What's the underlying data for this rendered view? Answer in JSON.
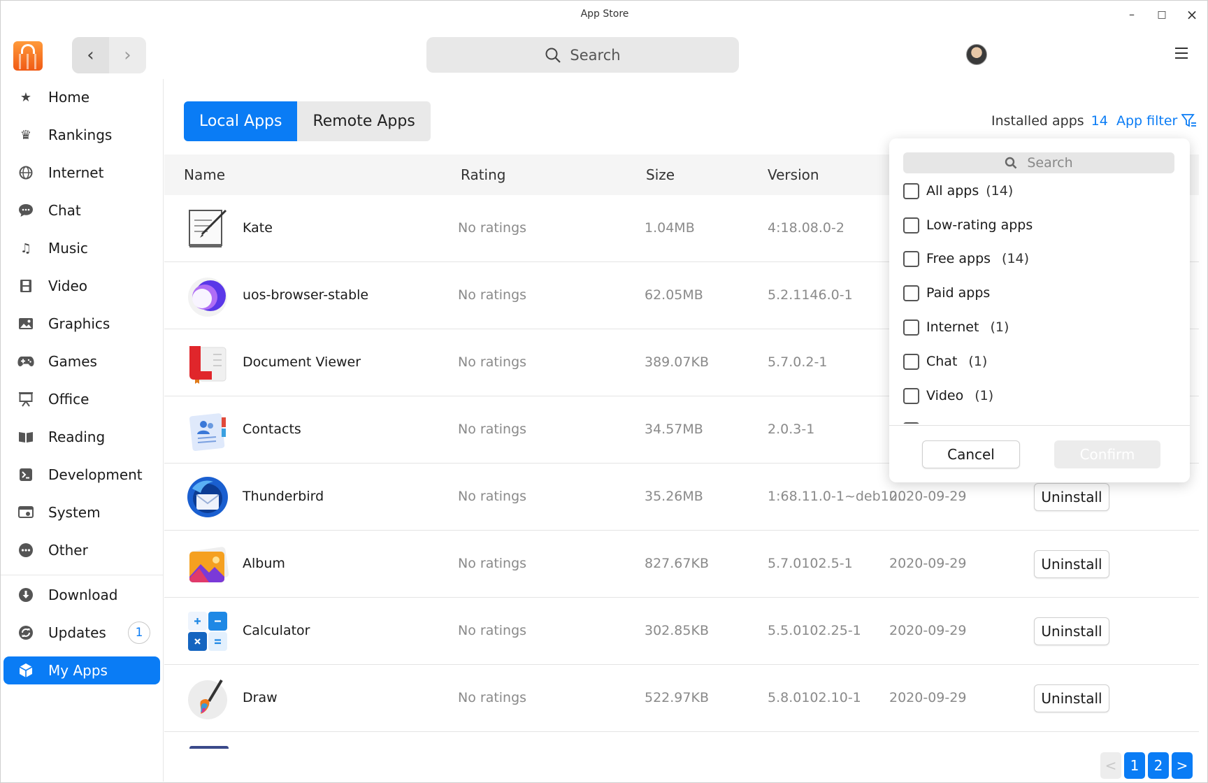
{
  "window": {
    "title": "App Store",
    "minimize": "–",
    "maximize": "□",
    "close": "×"
  },
  "topbar": {
    "search_placeholder": "Search",
    "back": "‹",
    "forward": "›"
  },
  "sidebar": {
    "items": [
      {
        "label": "Home",
        "icon": "star-icon"
      },
      {
        "label": "Rankings",
        "icon": "crown-icon"
      },
      {
        "label": "Internet",
        "icon": "globe-icon"
      },
      {
        "label": "Chat",
        "icon": "chat-bubble-icon"
      },
      {
        "label": "Music",
        "icon": "music-note-icon"
      },
      {
        "label": "Video",
        "icon": "film-icon"
      },
      {
        "label": "Graphics",
        "icon": "image-icon"
      },
      {
        "label": "Games",
        "icon": "gamepad-icon"
      },
      {
        "label": "Office",
        "icon": "presentation-icon"
      },
      {
        "label": "Reading",
        "icon": "book-icon"
      },
      {
        "label": "Development",
        "icon": "terminal-icon"
      },
      {
        "label": "System",
        "icon": "system-icon"
      },
      {
        "label": "Other",
        "icon": "ellipsis-icon"
      }
    ],
    "bottom_items": [
      {
        "label": "Download",
        "icon": "download-icon"
      },
      {
        "label": "Updates",
        "icon": "refresh-icon",
        "badge": "1"
      },
      {
        "label": "My Apps",
        "icon": "box-icon",
        "active": true
      }
    ]
  },
  "main": {
    "tabs": [
      {
        "label": "Local Apps",
        "active": true
      },
      {
        "label": "Remote Apps",
        "active": false
      }
    ],
    "installed_label": "Installed apps",
    "installed_count": "14",
    "app_filter_label": "App filter",
    "columns": [
      "Name",
      "Rating",
      "Size",
      "Version"
    ],
    "uninstall_label": "Uninstall",
    "rows": [
      {
        "name": "Kate",
        "rating": "No ratings",
        "size": "1.04MB",
        "version": "4:18.08.0-2",
        "date": ""
      },
      {
        "name": "uos-browser-stable",
        "rating": "No ratings",
        "size": "62.05MB",
        "version": "5.2.1146.0-1",
        "date": ""
      },
      {
        "name": "Document Viewer",
        "rating": "No ratings",
        "size": "389.07KB",
        "version": "5.7.0.2-1",
        "date": ""
      },
      {
        "name": "Contacts",
        "rating": "No ratings",
        "size": "34.57MB",
        "version": "2.0.3-1",
        "date": ""
      },
      {
        "name": "Thunderbird",
        "rating": "No ratings",
        "size": "35.26MB",
        "version": "1:68.11.0-1~deb10...",
        "date": "2020-09-29"
      },
      {
        "name": "Album",
        "rating": "No ratings",
        "size": "827.67KB",
        "version": "5.7.0102.5-1",
        "date": "2020-09-29"
      },
      {
        "name": "Calculator",
        "rating": "No ratings",
        "size": "302.85KB",
        "version": "5.5.0102.25-1",
        "date": "2020-09-29"
      },
      {
        "name": "Draw",
        "rating": "No ratings",
        "size": "522.97KB",
        "version": "5.8.0102.10-1",
        "date": "2020-09-29"
      }
    ],
    "pagination": {
      "prev": "<",
      "pages": [
        "1",
        "2"
      ],
      "next": ">"
    }
  },
  "filter_popup": {
    "search_placeholder": "Search",
    "options": [
      {
        "label": "All apps",
        "count": "(14)"
      },
      {
        "label": "Low-rating apps",
        "count": ""
      },
      {
        "label": "Free apps",
        "count": "(14)"
      },
      {
        "label": "Paid apps",
        "count": ""
      },
      {
        "label": "Internet",
        "count": "(1)"
      },
      {
        "label": "Chat",
        "count": "(1)"
      },
      {
        "label": "Video",
        "count": "(1)"
      }
    ],
    "cancel_label": "Cancel",
    "confirm_label": "Confirm"
  },
  "colors": {
    "accent": "#0a7cf5",
    "logo": "#f05a14"
  }
}
